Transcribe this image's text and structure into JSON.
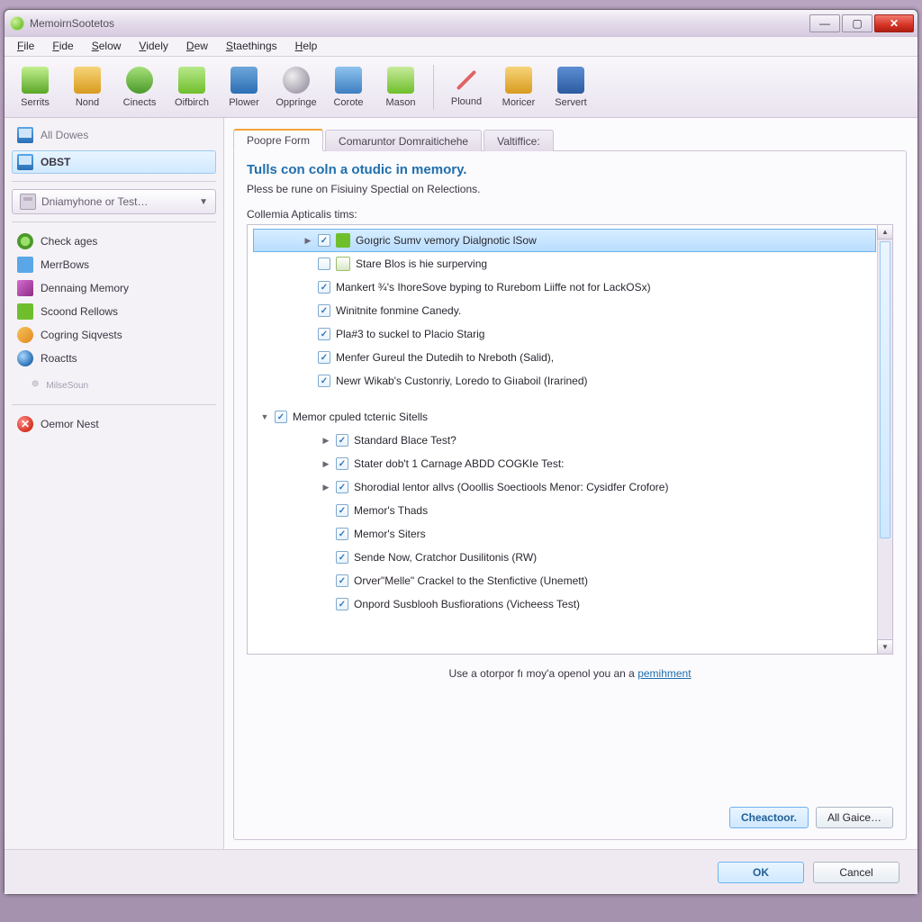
{
  "window": {
    "title": "MemoirnSootetos"
  },
  "win_controls": {
    "min": "—",
    "max": "▢",
    "close": "✕"
  },
  "menu": [
    "File",
    "Fide",
    "Selow",
    "Videly",
    "Dew",
    "Staethings",
    "Help"
  ],
  "toolbar": [
    {
      "label": "Serrits",
      "ic": "ic-a"
    },
    {
      "label": "Nond",
      "ic": "ic-b"
    },
    {
      "label": "Cinects",
      "ic": "ic-c"
    },
    {
      "label": "Oifbirch",
      "ic": "ic-d"
    },
    {
      "label": "Plower",
      "ic": "ic-e"
    },
    {
      "label": "Oppringe",
      "ic": "ic-f"
    },
    {
      "label": "Corote",
      "ic": "ic-g"
    },
    {
      "label": "Mason",
      "ic": "ic-h"
    },
    {
      "sep": true
    },
    {
      "label": "Plound",
      "ic": "ic-j"
    },
    {
      "label": "Moricer",
      "ic": "ic-k"
    },
    {
      "label": "Servert",
      "ic": "ic-l"
    }
  ],
  "sidebar": {
    "heading": "All Dowes",
    "active": "OBST",
    "dropdown": "Dniamyhone or Test…",
    "items": [
      {
        "label": "Check ages",
        "ic": "gear"
      },
      {
        "label": "MerrBows",
        "ic": "blue"
      },
      {
        "label": "Dennaing Memory",
        "ic": "mag"
      },
      {
        "label": "Scoond Rellows",
        "ic": "grn"
      },
      {
        "label": "Cogring Siqvests",
        "ic": "org"
      },
      {
        "label": "Roactts",
        "ic": "globe"
      }
    ],
    "footnote": "MilseSoun",
    "error_item": "Oemor Nest"
  },
  "tabs": [
    "Poopre Form",
    "Comaruntor Domraitichehe",
    "Valtiffice:"
  ],
  "panel": {
    "title": "Tulls con coln a otudic in memory.",
    "sub": "Pless be rune on Fisiuiny Spectial on Relections.",
    "sec_label": "Collemia Apticalis tims:",
    "tree_group1": [
      {
        "label": "Goıgric Sumv vemory Dialgnotic lSow",
        "sel": true,
        "ic": "ic-green-sq",
        "exp": "▶",
        "checked": true
      },
      {
        "label": "Stare Blos is hie surperving",
        "ic": "ic-env",
        "checked": false
      },
      {
        "label": "Mankert ¾'s IhoreSove byping to Rurebom Liiffe not for LackOSx)",
        "checked": true
      },
      {
        "label": "Winitnite fonmine Canedy.",
        "checked": true
      },
      {
        "label": "Pla#3 to suckel to Placio Starig",
        "checked": true
      },
      {
        "label": "Menfer Gureul the Dutedih to Nreboth (Salid),",
        "checked": true
      },
      {
        "label": "Newr Wikab's Custonriy, Loredo to Giıaboil (Irarined)",
        "checked": true
      }
    ],
    "tree_group2_header": {
      "label": "Memor cpuled tcterıic Sitells",
      "exp": "▼",
      "checked": true
    },
    "tree_group2": [
      {
        "label": "Standard Blace Test?",
        "exp": "▶",
        "checked": true
      },
      {
        "label": "Stater dob't 1 Carnage ABDD COGKIe Test:",
        "exp": "▶",
        "checked": true
      },
      {
        "label": "Shorodial lentor allvs (Ooollis Soectiools Menor: Cysidfer Crofore)",
        "exp": "▶",
        "checked": true
      },
      {
        "label": "Memor's Thads",
        "checked": true
      },
      {
        "label": "Memor's Siters",
        "checked": true
      },
      {
        "label": "Sende Now, Cratchor Dusilitonis (RW)",
        "checked": true
      },
      {
        "label": "Orver\"Melle\" Crackel to the Stenfictive (Unemett)",
        "checked": true
      },
      {
        "label": "Onpord Susblooh Busfiorations (Vicheess Test)",
        "checked": true
      }
    ],
    "hint_pre": "Use a otorpor fı moy'a openol you an a ",
    "hint_link": "pemihment",
    "buttons": {
      "a": "Cheactoor.",
      "b": "All Gaice…"
    }
  },
  "bottom": {
    "ok": "OK",
    "cancel": "Cancel"
  }
}
